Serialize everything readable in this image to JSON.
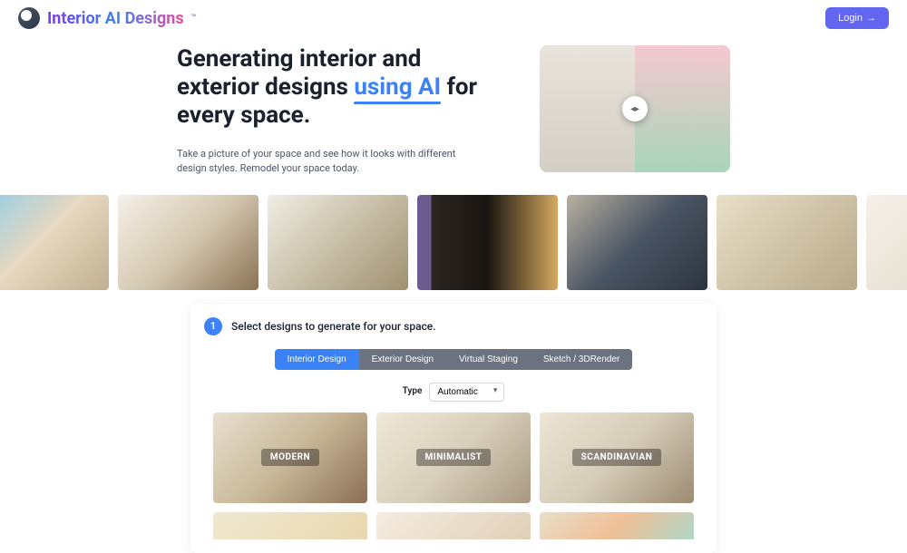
{
  "brand": {
    "name": "Interior AI Designs",
    "trademark": "™"
  },
  "header": {
    "login_label": "Login"
  },
  "hero": {
    "title_part1": "Generating interior and exterior designs ",
    "title_highlight": "using AI",
    "title_part2": " for every space.",
    "subtitle": "Take a picture of your space and see how it looks with different design styles. Remodel your space today."
  },
  "panel": {
    "step_number": "1",
    "step_text": "Select designs to generate for your space.",
    "tabs": [
      {
        "label": "Interior Design",
        "active": true
      },
      {
        "label": "Exterior Design",
        "active": false
      },
      {
        "label": "Virtual Staging",
        "active": false
      },
      {
        "label": "Sketch / 3DRender",
        "active": false
      }
    ],
    "type_label": "Type",
    "type_value": "Automatic",
    "designs": [
      {
        "name": "MODERN"
      },
      {
        "name": "MINIMALIST"
      },
      {
        "name": "SCANDINAVIAN"
      }
    ]
  }
}
